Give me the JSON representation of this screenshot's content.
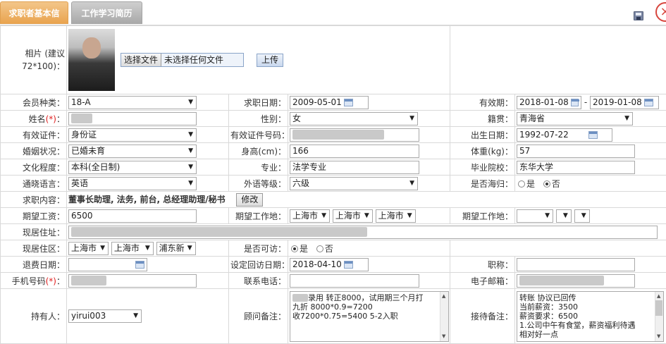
{
  "tabs": {
    "active": "求职者基本信息",
    "inactive": "工作学习简历"
  },
  "photo": {
    "label": "相片 (建议72*100)：",
    "choose_file": "选择文件",
    "no_file": "未选择任何文件",
    "upload": "上传"
  },
  "row_member": {
    "member_type_label": "会员种类：",
    "member_type": "18-A",
    "apply_date_label": "求职日期：",
    "apply_date": "2009-05-01",
    "valid_label": "有效期：",
    "valid_from": "2018-01-08",
    "valid_sep": "-",
    "valid_to": "2019-01-08"
  },
  "row_name": {
    "name_label": "姓名",
    "gender_label": "性别：",
    "gender": "女",
    "native_label": "籍贯：",
    "native": "青海省"
  },
  "row_id": {
    "id_type_label": "有效证件：",
    "id_type": "身份证",
    "id_no_label": "有效证件号码：",
    "birth_label": "出生日期：",
    "birth": "1992-07-22"
  },
  "row_marriage": {
    "marriage_label": "婚姻状况：",
    "marriage": "已婚未育",
    "height_label": "身高(cm)：",
    "height": "166",
    "weight_label": "体重(kg)：",
    "weight": "57"
  },
  "row_edu": {
    "edu_label": "文化程度：",
    "edu": "本科(全日制)",
    "major_label": "专业：",
    "major": "法学专业",
    "school_label": "毕业院校：",
    "school": "东华大学"
  },
  "row_lang": {
    "lang_label": "通晓语言：",
    "lang": "英语",
    "level_label": "外语等级：",
    "level": "六级",
    "overseas_label": "是否海归：",
    "yes": "是",
    "no": "否"
  },
  "row_content": {
    "label": "求职内容：",
    "value": "董事长助理, 法务, 前台, 总经理助理/秘书",
    "edit": "修改"
  },
  "row_salary": {
    "salary_label": "期望工资：",
    "salary": "6500",
    "place_label": "期望工作地：",
    "p1": "上海市",
    "p2": "上海市",
    "p3": "上海市",
    "place2_label": "期望工作地：",
    "q1": "",
    "q2": "",
    "q3": ""
  },
  "row_addr": {
    "label": "现居住址："
  },
  "row_area": {
    "label": "现居住区：",
    "a1": "上海市",
    "a2": "上海市",
    "a3": "浦东新",
    "contact_label": "是否可访：",
    "yes": "是",
    "no": "否"
  },
  "row_refund": {
    "refund_label": "退费日期：",
    "visit_label": "设定回访日期：",
    "visit": "2018-04-10",
    "title_label": "职称："
  },
  "row_phone": {
    "mobile_label": "手机号码",
    "tel_label": "联系电话：",
    "email_label": "电子邮箱："
  },
  "row_owner": {
    "owner_label": "持有人：",
    "owner": "yirui003",
    "consult_label": "顾问备注：",
    "consult_lines": [
      "录用 转正8000，试用期三个月打",
      "九折 8000*0.9=7200",
      "收7200*0.75=5400 5-2入职"
    ],
    "reception_label": "接待备注：",
    "reception_lines": [
      "转账 协议已回传",
      "当前薪资：3500",
      "薪资要求：6500",
      "1.公司中午有食堂，薪资福利待遇",
      "相对好一点"
    ]
  },
  "colors": {
    "active_tab": "#e9a44f",
    "inactive_tab": "#a9a9a9",
    "required": "#e02020",
    "close": "#d7463e"
  },
  "icons": [
    "save-icon",
    "close-icon",
    "calendar-icon",
    "chevron-down-icon"
  ]
}
